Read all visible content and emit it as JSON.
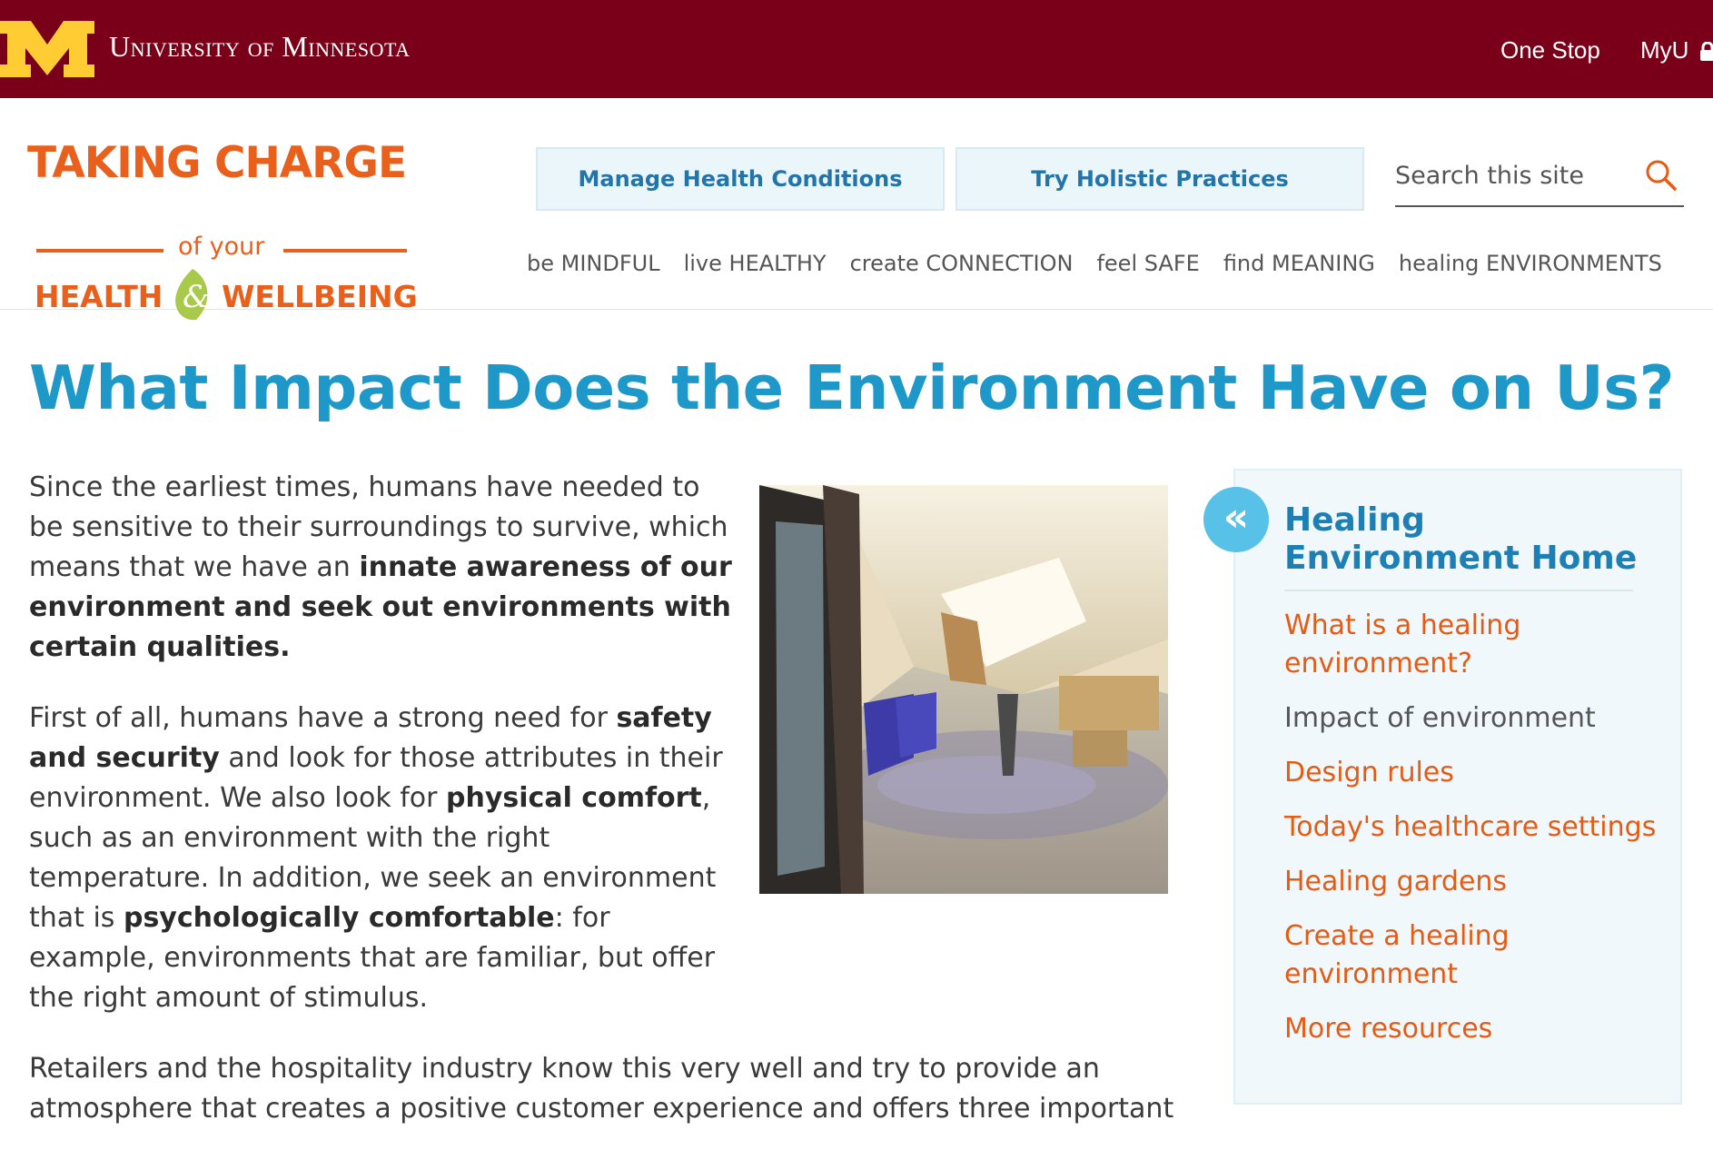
{
  "umn": {
    "name": "University of Minnesota",
    "links": [
      "One Stop",
      "MyU"
    ],
    "colors": {
      "maroon": "#7a0019",
      "gold": "#ffcc33"
    }
  },
  "site": {
    "logo": {
      "line1": "TAKING CHARGE",
      "line2": "of your",
      "line3_left": "HEALTH",
      "line3_amp": "&",
      "line3_right": "WELLBEING"
    },
    "cta": [
      "Manage Health Conditions",
      "Try Holistic Practices"
    ],
    "search": {
      "placeholder": "Search this site",
      "icon": "search-icon"
    },
    "nav": [
      "be MINDFUL",
      "live HEALTHY",
      "create CONNECTION",
      "feel SAFE",
      "find MEANING",
      "healing ENVIRONMENTS"
    ]
  },
  "main": {
    "title": "What Impact Does the Environment Have on Us?",
    "p1": {
      "a": "Since the earliest times, humans have needed to be sensitive to their surroundings to survive, which means that we have an ",
      "b": "innate awareness of our environment and seek out environments with certain qualities.",
      "c": ""
    },
    "p2": {
      "t1": "First of all, humans have a strong need for ",
      "b1": "safety and security",
      "t2": " and look for those attributes in their environment. We also look for ",
      "b2": "physical comfort",
      "t3": ", such as an environment with the right temperature. In addition, we seek an environment that is ",
      "b3": "psychologically comfortable",
      "t4": ": for example, environments that are familiar, but offer the right amount of stimulus."
    },
    "p3": "Retailers and the hospitality industry know this very well and try to provide an atmosphere that creates a positive customer experience and offers three important"
  },
  "sidebar": {
    "back_icon": "«",
    "home": "Healing Environment Home",
    "items": [
      {
        "label": "What is a healing environment?",
        "current": false
      },
      {
        "label": "Impact of environment",
        "current": true
      },
      {
        "label": "Design rules",
        "current": false
      },
      {
        "label": "Today's healthcare settings",
        "current": false
      },
      {
        "label": "Healing gardens",
        "current": false
      },
      {
        "label": "Create a healing environment",
        "current": false
      },
      {
        "label": "More resources",
        "current": false
      }
    ]
  },
  "colors": {
    "accent_orange": "#e8601c",
    "title_blue": "#1e98c8",
    "link_orange": "#e55b13"
  }
}
